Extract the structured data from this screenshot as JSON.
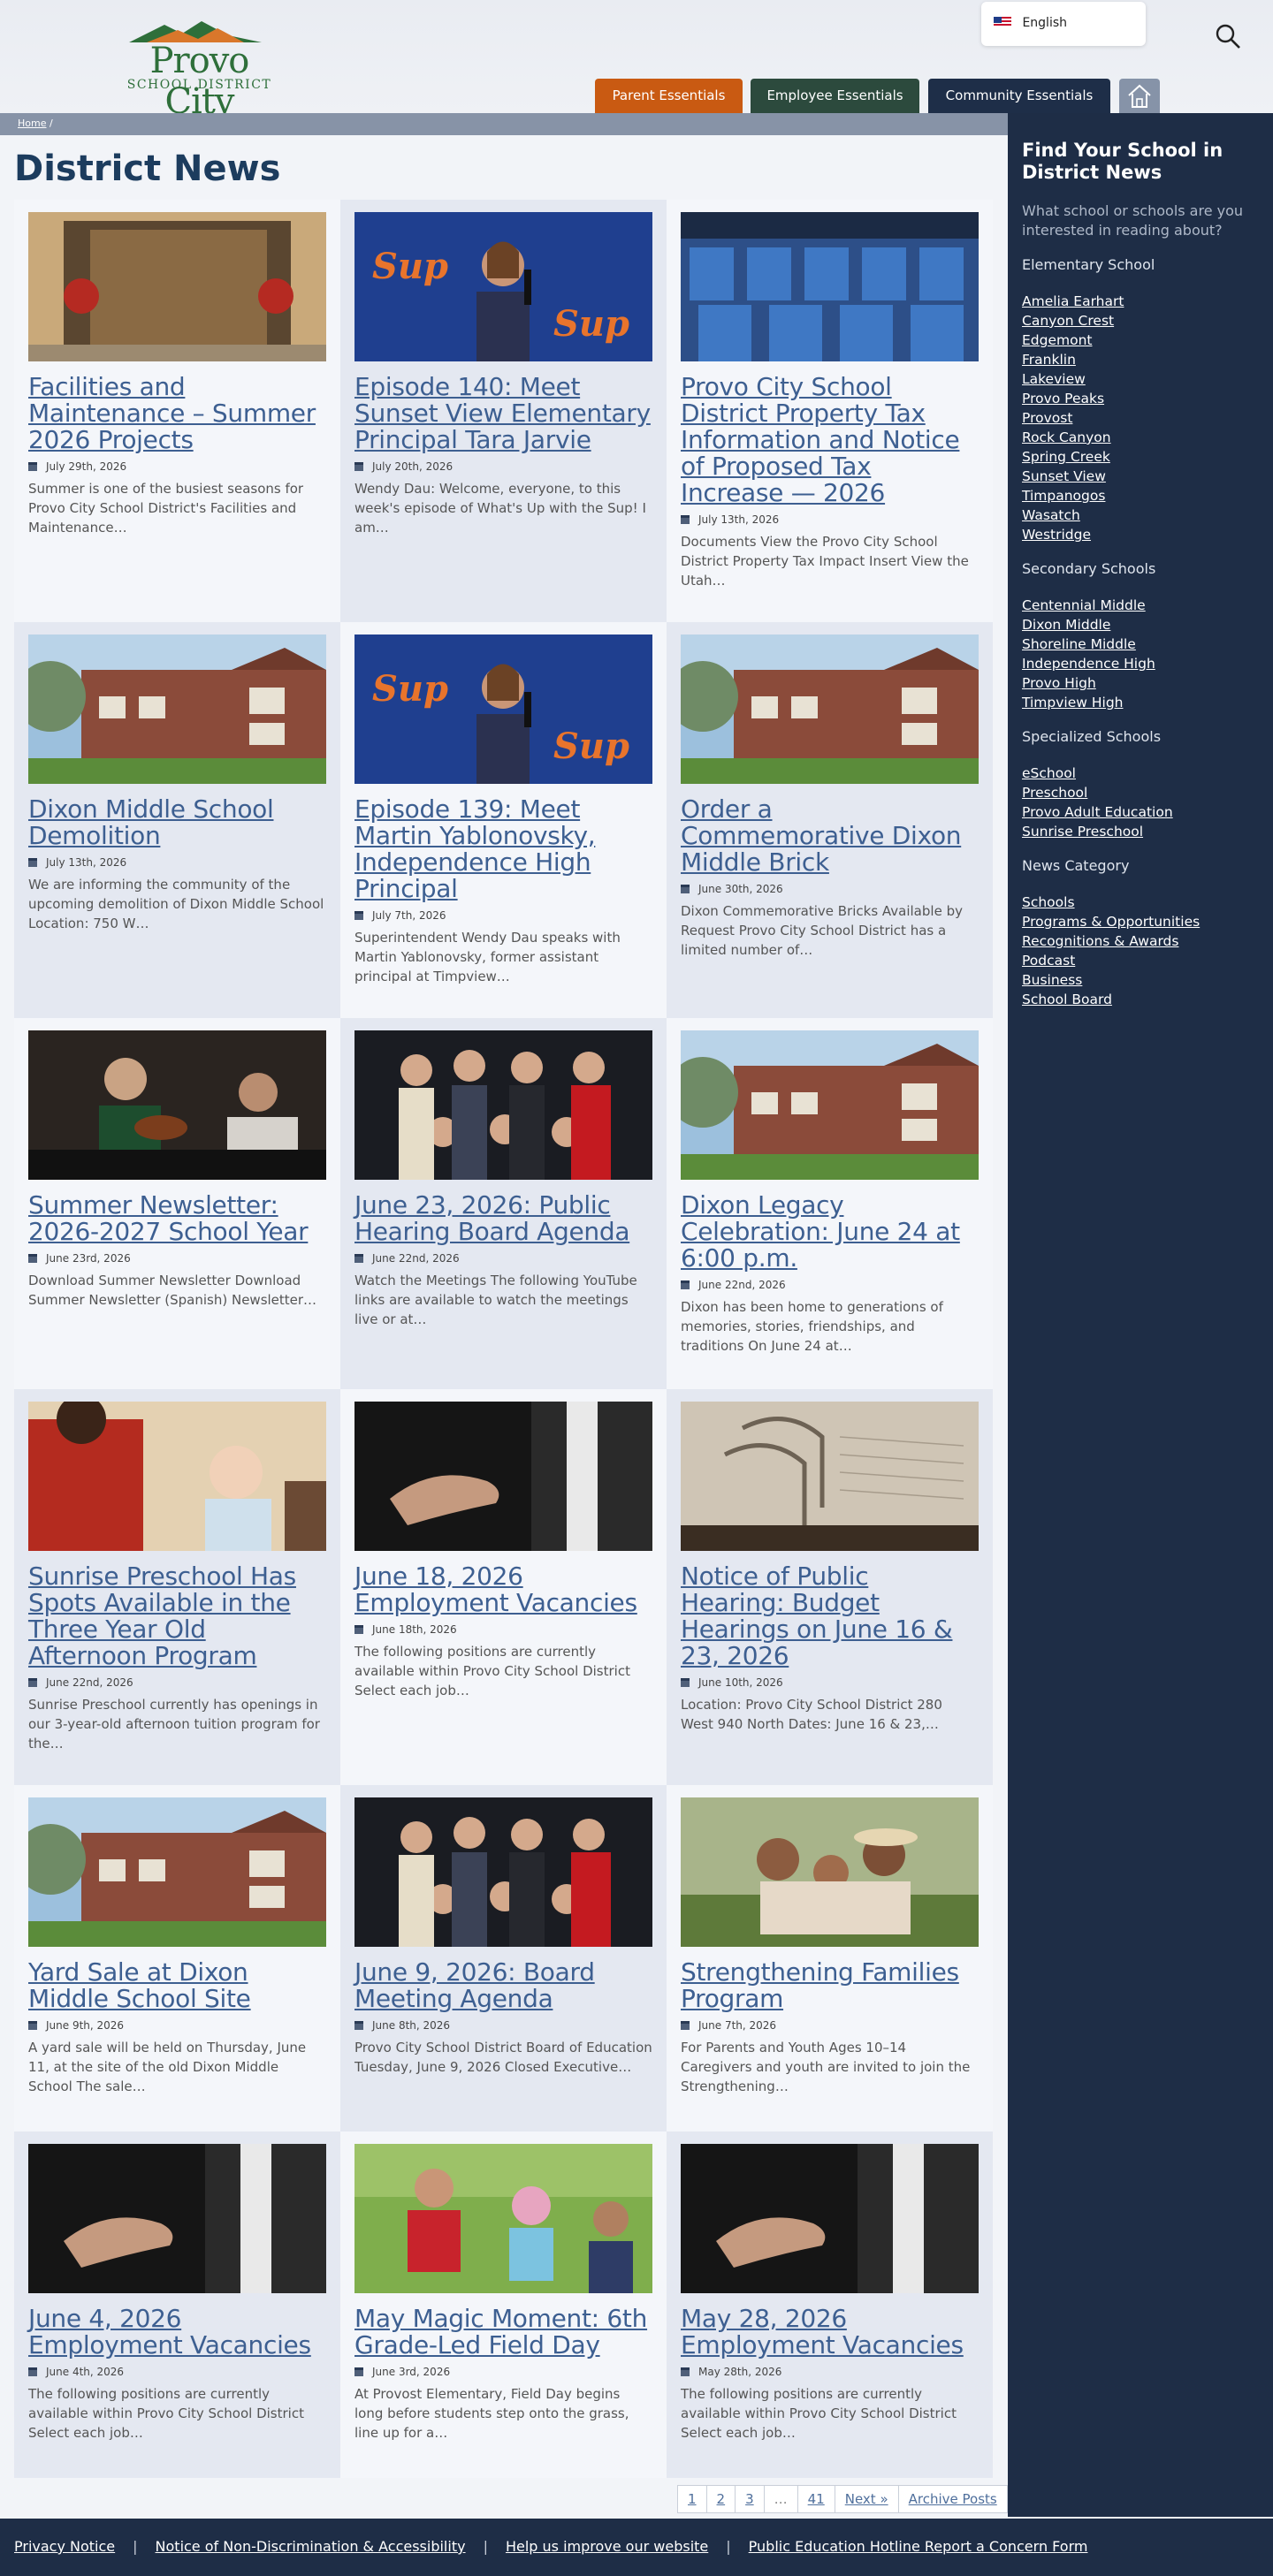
{
  "header": {
    "logo": {
      "name": "Provo City",
      "sub": "SCHOOL DISTRICT"
    },
    "language": "English",
    "nav": [
      "Parent Essentials",
      "Employee Essentials",
      "Community Essentials"
    ]
  },
  "breadcrumb": {
    "home": "Home",
    "sep": "/"
  },
  "page_title": "District News",
  "cards": [
    {
      "title": "Facilities and Maintenance – Summer 2026 Projects",
      "date": "July 29th, 2026",
      "excerpt": "Summer is one of the busiest seasons for Provo City School District's Facilities and Maintenance…",
      "image": "trailer"
    },
    {
      "title": "Episode 140: Meet Sunset View Elementary Principal Tara Jarvie",
      "date": "July 20th, 2026",
      "excerpt": "  Wendy Dau: Welcome, everyone, to this week's episode of What's Up with the Sup! I am…",
      "image": "podcast"
    },
    {
      "title": "Provo City School District Property Tax Information and Notice of Proposed Tax Increase — 2026",
      "date": "July 13th, 2026",
      "excerpt": "Documents View the Provo City School District Property Tax Impact Insert View the Utah…",
      "image": "chairs"
    },
    {
      "title": "Dixon Middle School Demolition",
      "date": "July 13th, 2026",
      "excerpt": "We are informing the community of the upcoming demolition of Dixon Middle School Location: 750 W…",
      "image": "building"
    },
    {
      "title": "Episode 139: Meet Martin Yablonovsky, Independence High Principal",
      "date": "July 7th, 2026",
      "excerpt": "Superintendent Wendy Dau speaks with Martin Yablonovsky, former assistant principal at Timpview…",
      "image": "podcast"
    },
    {
      "title": "Order a Commemorative Dixon Middle Brick",
      "date": "June 30th, 2026",
      "excerpt": "Dixon Commemorative Bricks Available by Request Provo City School District has a limited number of…",
      "image": "building"
    },
    {
      "title": "Summer Newsletter: 2026-2027 School Year",
      "date": "June 23rd, 2026",
      "excerpt": "Download Summer Newsletter Download Summer Newsletter (Spanish) Newsletter…",
      "image": "violins"
    },
    {
      "title": "June 23, 2026: Public Hearing Board Agenda",
      "date": "June 22nd, 2026",
      "excerpt": "Watch the Meetings The following YouTube links are available to watch the meetings live or at…",
      "image": "board"
    },
    {
      "title": "Dixon Legacy Celebration: June 24 at 6:00 p.m.",
      "date": "June 22nd, 2026",
      "excerpt": "Dixon has been home to generations of memories, stories, friendships, and traditions On June 24 at…",
      "image": "building"
    },
    {
      "title": "Sunrise Preschool Has Spots Available in the Three Year Old Afternoon Program",
      "date": "June 22nd, 2026",
      "excerpt": "Sunrise Preschool currently has openings in our 3-year-old afternoon tuition program for the…",
      "image": "preschool"
    },
    {
      "title": "June 18, 2026 Employment Vacancies",
      "date": "June 18th, 2026",
      "excerpt": "The following positions are currently available within Provo City School District Select each job…",
      "image": "handshake"
    },
    {
      "title": "Notice of Public Hearing: Budget Hearings on June 16 & 23, 2026",
      "date": "June 10th, 2026",
      "excerpt": "Location: Provo City School District  280 West 940 North Dates: June 16 & 23,…",
      "image": "binder"
    },
    {
      "title": "Yard Sale at Dixon Middle School Site",
      "date": "June 9th, 2026",
      "excerpt": "A yard sale will be held on Thursday, June 11, at the site of the old Dixon Middle School The sale…",
      "image": "building"
    },
    {
      "title": "June 9, 2026: Board Meeting Agenda",
      "date": "June 8th, 2026",
      "excerpt": "  Provo City School District Board of Education Tuesday, June 9, 2026 Closed Executive…",
      "image": "board"
    },
    {
      "title": "Strengthening Families Program",
      "date": "June 7th, 2026",
      "excerpt": "For Parents and Youth Ages 10–14 Caregivers and youth are invited to join the Strengthening…",
      "image": "family"
    },
    {
      "title": "June 4, 2026 Employment Vacancies",
      "date": "June 4th, 2026",
      "excerpt": "The following positions are currently available within Provo City School District Select each job…",
      "image": "handshake"
    },
    {
      "title": "May Magic Moment: 6th Grade-Led Field Day",
      "date": "June 3rd, 2026",
      "excerpt": "At Provost Elementary, Field Day begins long before students step onto the grass, line up for a…",
      "image": "fieldday"
    },
    {
      "title": "May 28, 2026 Employment Vacancies",
      "date": "May 28th, 2026",
      "excerpt": "The following positions are currently available within Provo City School District Select each job…",
      "image": "handshake"
    }
  ],
  "pagination": [
    "1",
    "2",
    "3",
    "…",
    "41",
    "Next »",
    "Archive Posts"
  ],
  "sidebar": {
    "title": "Find Your School in District News",
    "intro": "What school or schools are you interested in reading about?",
    "groups": [
      {
        "heading": "Elementary School",
        "links": [
          "Amelia Earhart",
          "Canyon Crest",
          "Edgemont",
          "Franklin",
          "Lakeview",
          "Provo Peaks",
          "Provost",
          "Rock Canyon",
          "Spring Creek",
          "Sunset View",
          "Timpanogos",
          "Wasatch",
          "Westridge"
        ]
      },
      {
        "heading": "Secondary Schools",
        "links": [
          "Centennial Middle",
          "Dixon Middle",
          "Shoreline Middle",
          "Independence High",
          "Provo High",
          "Timpview High"
        ]
      },
      {
        "heading": "Specialized Schools",
        "links": [
          "eSchool",
          "Preschool",
          "Provo Adult Education",
          "Sunrise Preschool"
        ]
      },
      {
        "heading": "News Category",
        "links": [
          "Schools",
          "Programs & Opportunities",
          "Recognitions & Awards",
          "Podcast",
          "Business",
          "School Board"
        ]
      }
    ]
  },
  "footer": [
    "Privacy Notice",
    "Notice of Non-Discrimination & Accessibility",
    "Help us improve our website",
    "Public Education Hotline Report a Concern Form"
  ]
}
